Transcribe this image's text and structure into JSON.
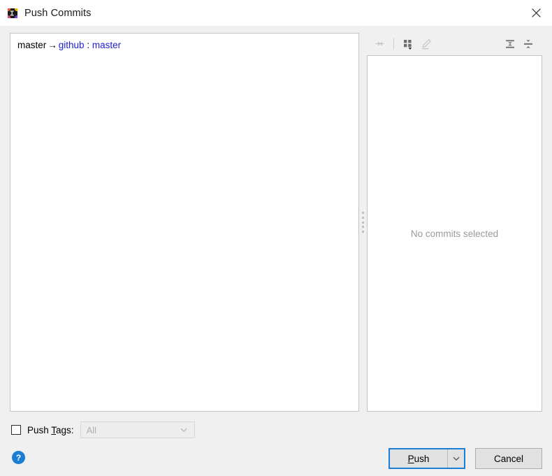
{
  "window": {
    "title": "Push Commits",
    "app_icon": "intellij-idea-icon",
    "close_icon": "close-icon"
  },
  "commits_panel": {
    "branch": {
      "local": "master",
      "arrow": "→",
      "remote": "github",
      "separator": ":",
      "remote_branch": "master"
    }
  },
  "detail_toolbar": {
    "buttons": [
      {
        "name": "show-diff-icon",
        "title": "Show Diff",
        "enabled": false
      },
      {
        "name": "group-by-icon",
        "title": "Group By",
        "enabled": true
      },
      {
        "name": "edit-source-icon",
        "title": "Edit Source",
        "enabled": false
      },
      {
        "name": "expand-all-icon",
        "title": "Expand All",
        "enabled": true
      },
      {
        "name": "collapse-all-icon",
        "title": "Collapse All",
        "enabled": true
      }
    ]
  },
  "detail_panel": {
    "empty_message": "No commits selected"
  },
  "push_tags": {
    "label_prefix": "Push ",
    "label_mnemonic": "T",
    "label_suffix": "ags:",
    "checked": false,
    "combo_value": "All",
    "combo_enabled": false,
    "chevron_icon": "chevron-down-icon"
  },
  "help": {
    "icon": "help-icon",
    "glyph": "?"
  },
  "buttons": {
    "push_prefix": "",
    "push_mnemonic": "P",
    "push_suffix": "ush",
    "push_dropdown_icon": "chevron-down-icon",
    "cancel_label": "Cancel"
  },
  "colors": {
    "dialog_bg": "#f0f0f0",
    "panel_bg": "#ffffff",
    "link": "#2020d0",
    "focus_ring": "#1a7fd4",
    "muted_text": "#9a9a9a",
    "help_blue": "#1a7fd4"
  }
}
